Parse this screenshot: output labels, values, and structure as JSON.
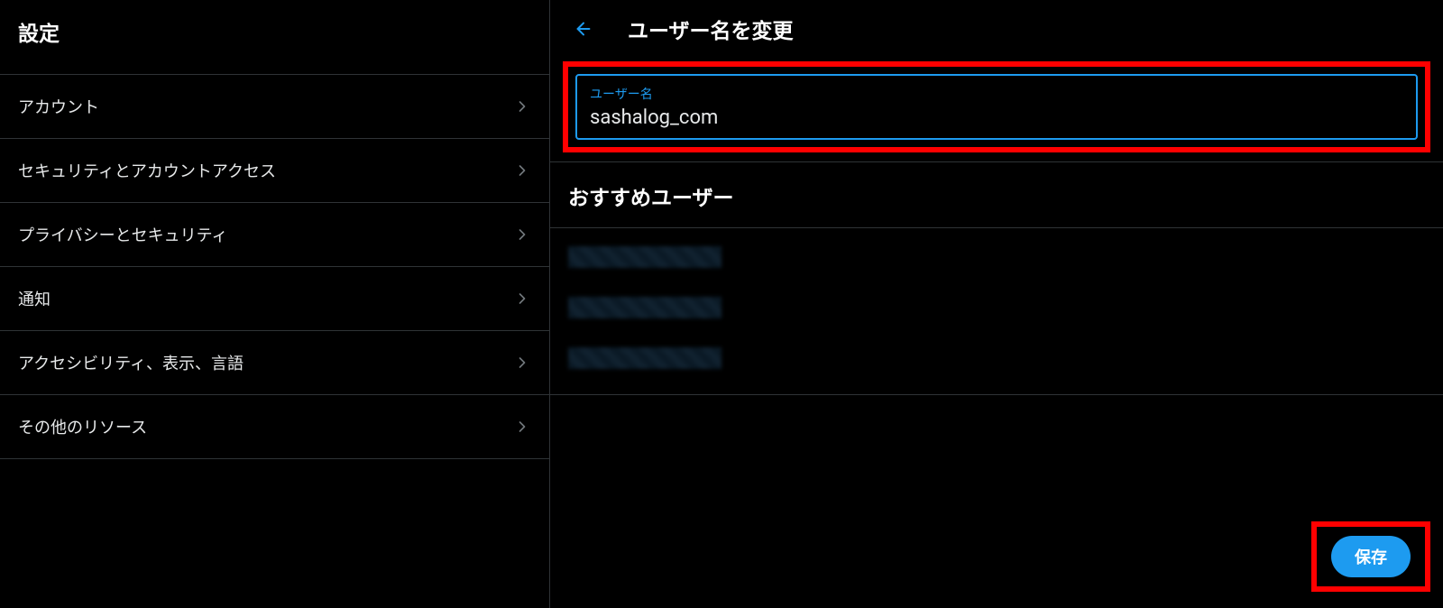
{
  "sidebar": {
    "title": "設定",
    "items": [
      {
        "label": "アカウント"
      },
      {
        "label": "セキュリティとアカウントアクセス"
      },
      {
        "label": "プライバシーとセキュリティ"
      },
      {
        "label": "通知"
      },
      {
        "label": "アクセシビリティ、表示、言語"
      },
      {
        "label": "その他のリソース"
      }
    ]
  },
  "detail": {
    "title": "ユーザー名を変更",
    "input": {
      "label": "ユーザー名",
      "value": "sashalog_com"
    },
    "suggestions": {
      "title": "おすすめユーザー"
    },
    "saveButton": "保存"
  }
}
